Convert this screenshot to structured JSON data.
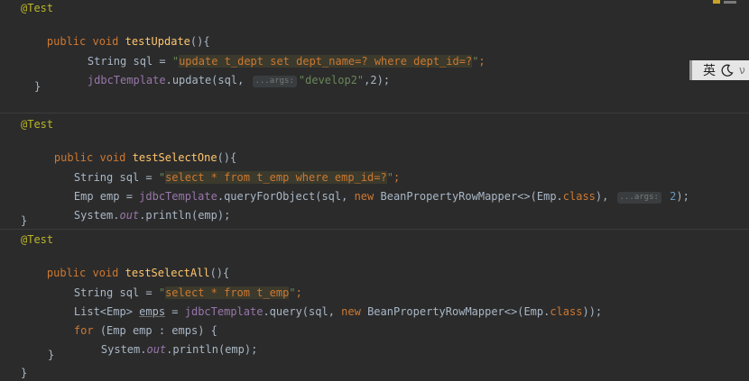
{
  "editor": {
    "methods": [
      {
        "annotation": "@Test",
        "signature": {
          "modifier": "public",
          "type": "void",
          "name": "testUpdate",
          "params": "(){"
        },
        "body": {
          "line1": {
            "type": "String",
            "var": " sql = ",
            "q1": "\"",
            "sql": "update t_dept set dept_name=? where dept_id=?",
            "q2": "\"",
            "end": ";"
          },
          "line2": {
            "obj": "jdbcTemplate",
            "call": ".update(sql, ",
            "hint": "...args:",
            "args_str": "\"develop2\"",
            "args_rest": ",2);"
          }
        },
        "close": "}"
      },
      {
        "annotation": "@Test",
        "signature": {
          "modifier": "public",
          "type": "void",
          "name": "testSelectOne",
          "params": "(){"
        },
        "body": {
          "line1": {
            "type": "String",
            "var": " sql = ",
            "q1": "\"",
            "sql": "select * from t_emp where emp_id=?",
            "q2": "\"",
            "end": ";"
          },
          "line2": {
            "prefix": "Emp emp = ",
            "obj": "jdbcTemplate",
            "call": ".queryForObject(sql, ",
            "new_kw": "new",
            "rowmapper": " BeanPropertyRowMapper<>(Emp.",
            "class_kw": "class",
            "after": "), ",
            "hint": "...args:",
            "num": " 2",
            "end": ");"
          },
          "line3": {
            "sys": "System.",
            "out": "out",
            "print": ".println(emp);"
          }
        },
        "close": "}"
      },
      {
        "annotation": "@Test",
        "signature": {
          "modifier": "public",
          "type": "void",
          "name": "testSelectAll",
          "params": "(){"
        },
        "body": {
          "line1": {
            "type": "String",
            "var": " sql = ",
            "q1": "\"",
            "sql": "select * from t_emp",
            "q2": "\"",
            "end": ";"
          },
          "line2": {
            "prefix": "List<Emp> ",
            "var": "emps",
            "eq": " = ",
            "obj": "jdbcTemplate",
            "call": ".query(sql, ",
            "new_kw": "new",
            "rowmapper": " BeanPropertyRowMapper<>(Emp.",
            "class_kw": "class",
            "end": "));"
          },
          "line3": {
            "kw": "for",
            "rest": " (Emp emp : emps) {"
          },
          "line4": {
            "sys": "System.",
            "out": "out",
            "print": ".println(emp);"
          },
          "line5": "}"
        },
        "close": "}"
      }
    ]
  },
  "ime": {
    "label": "英",
    "moon_icon": "moon-icon",
    "extra": "ν"
  }
}
